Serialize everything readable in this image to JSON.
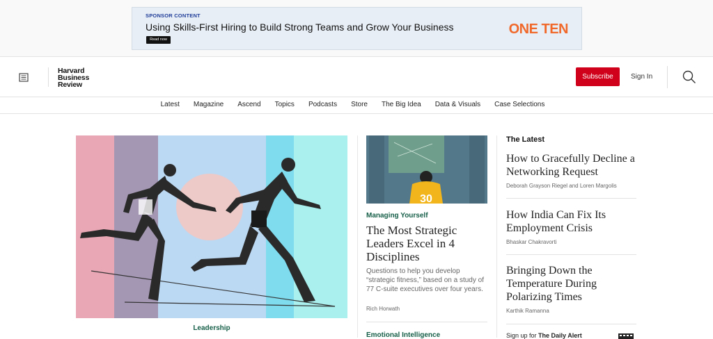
{
  "ad": {
    "tag": "SPONSOR CONTENT",
    "title": "Using Skills-First Hiring to Build Strong Teams and Grow Your Business",
    "button": "Read now",
    "brand": "ONE TEN"
  },
  "header": {
    "logo": [
      "Harvard",
      "Business",
      "Review"
    ],
    "subscribe": "Subscribe",
    "signin": "Sign In"
  },
  "nav": [
    "Latest",
    "Magazine",
    "Ascend",
    "Topics",
    "Podcasts",
    "Store",
    "The Big Idea",
    "Data & Visuals",
    "Case Selections"
  ],
  "hero": {
    "kicker": "Leadership"
  },
  "feature": {
    "kicker": "Managing Yourself",
    "title": "The Most Strategic Leaders Excel in 4 Disciplines",
    "description": "Questions to help you develop “strategic fitness,” based on a study of 77 C-suite executives over four years.",
    "author": "Rich Horwath",
    "next_kicker": "Emotional Intelligence",
    "jersey_number": "30"
  },
  "latest": {
    "heading": "The Latest",
    "items": [
      {
        "title": "How to Gracefully Decline a Networking Request",
        "author": "Deborah Grayson Riegel and Loren Margolis"
      },
      {
        "title": "How India Can Fix Its Employment Crisis",
        "author": "Bhaskar Chakravorti"
      },
      {
        "title": "Bringing Down the Temperature During Polarizing Times",
        "author": "Karthik Ramanna"
      }
    ],
    "signup_prefix": "Sign up for",
    "signup_name": "The Daily Alert"
  },
  "colors": {
    "accent_red": "#d0021b",
    "kicker_green": "#155e47",
    "brand_orange": "#f0692b"
  }
}
